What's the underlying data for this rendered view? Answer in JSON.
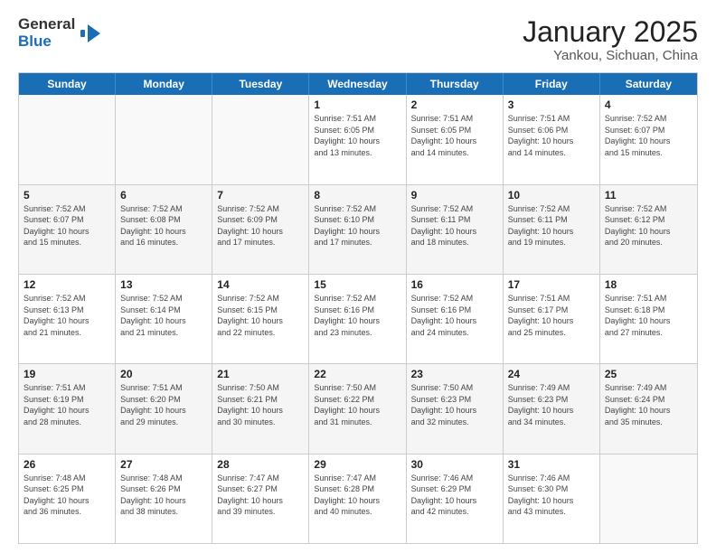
{
  "logo": {
    "text_general": "General",
    "text_blue": "Blue",
    "icon": "▶"
  },
  "title": {
    "month_year": "January 2025",
    "location": "Yankou, Sichuan, China"
  },
  "weekdays": [
    "Sunday",
    "Monday",
    "Tuesday",
    "Wednesday",
    "Thursday",
    "Friday",
    "Saturday"
  ],
  "rows": [
    [
      {
        "day": "",
        "info": ""
      },
      {
        "day": "",
        "info": ""
      },
      {
        "day": "",
        "info": ""
      },
      {
        "day": "1",
        "info": "Sunrise: 7:51 AM\nSunset: 6:05 PM\nDaylight: 10 hours\nand 13 minutes."
      },
      {
        "day": "2",
        "info": "Sunrise: 7:51 AM\nSunset: 6:05 PM\nDaylight: 10 hours\nand 14 minutes."
      },
      {
        "day": "3",
        "info": "Sunrise: 7:51 AM\nSunset: 6:06 PM\nDaylight: 10 hours\nand 14 minutes."
      },
      {
        "day": "4",
        "info": "Sunrise: 7:52 AM\nSunset: 6:07 PM\nDaylight: 10 hours\nand 15 minutes."
      }
    ],
    [
      {
        "day": "5",
        "info": "Sunrise: 7:52 AM\nSunset: 6:07 PM\nDaylight: 10 hours\nand 15 minutes."
      },
      {
        "day": "6",
        "info": "Sunrise: 7:52 AM\nSunset: 6:08 PM\nDaylight: 10 hours\nand 16 minutes."
      },
      {
        "day": "7",
        "info": "Sunrise: 7:52 AM\nSunset: 6:09 PM\nDaylight: 10 hours\nand 17 minutes."
      },
      {
        "day": "8",
        "info": "Sunrise: 7:52 AM\nSunset: 6:10 PM\nDaylight: 10 hours\nand 17 minutes."
      },
      {
        "day": "9",
        "info": "Sunrise: 7:52 AM\nSunset: 6:11 PM\nDaylight: 10 hours\nand 18 minutes."
      },
      {
        "day": "10",
        "info": "Sunrise: 7:52 AM\nSunset: 6:11 PM\nDaylight: 10 hours\nand 19 minutes."
      },
      {
        "day": "11",
        "info": "Sunrise: 7:52 AM\nSunset: 6:12 PM\nDaylight: 10 hours\nand 20 minutes."
      }
    ],
    [
      {
        "day": "12",
        "info": "Sunrise: 7:52 AM\nSunset: 6:13 PM\nDaylight: 10 hours\nand 21 minutes."
      },
      {
        "day": "13",
        "info": "Sunrise: 7:52 AM\nSunset: 6:14 PM\nDaylight: 10 hours\nand 21 minutes."
      },
      {
        "day": "14",
        "info": "Sunrise: 7:52 AM\nSunset: 6:15 PM\nDaylight: 10 hours\nand 22 minutes."
      },
      {
        "day": "15",
        "info": "Sunrise: 7:52 AM\nSunset: 6:16 PM\nDaylight: 10 hours\nand 23 minutes."
      },
      {
        "day": "16",
        "info": "Sunrise: 7:52 AM\nSunset: 6:16 PM\nDaylight: 10 hours\nand 24 minutes."
      },
      {
        "day": "17",
        "info": "Sunrise: 7:51 AM\nSunset: 6:17 PM\nDaylight: 10 hours\nand 25 minutes."
      },
      {
        "day": "18",
        "info": "Sunrise: 7:51 AM\nSunset: 6:18 PM\nDaylight: 10 hours\nand 27 minutes."
      }
    ],
    [
      {
        "day": "19",
        "info": "Sunrise: 7:51 AM\nSunset: 6:19 PM\nDaylight: 10 hours\nand 28 minutes."
      },
      {
        "day": "20",
        "info": "Sunrise: 7:51 AM\nSunset: 6:20 PM\nDaylight: 10 hours\nand 29 minutes."
      },
      {
        "day": "21",
        "info": "Sunrise: 7:50 AM\nSunset: 6:21 PM\nDaylight: 10 hours\nand 30 minutes."
      },
      {
        "day": "22",
        "info": "Sunrise: 7:50 AM\nSunset: 6:22 PM\nDaylight: 10 hours\nand 31 minutes."
      },
      {
        "day": "23",
        "info": "Sunrise: 7:50 AM\nSunset: 6:23 PM\nDaylight: 10 hours\nand 32 minutes."
      },
      {
        "day": "24",
        "info": "Sunrise: 7:49 AM\nSunset: 6:23 PM\nDaylight: 10 hours\nand 34 minutes."
      },
      {
        "day": "25",
        "info": "Sunrise: 7:49 AM\nSunset: 6:24 PM\nDaylight: 10 hours\nand 35 minutes."
      }
    ],
    [
      {
        "day": "26",
        "info": "Sunrise: 7:48 AM\nSunset: 6:25 PM\nDaylight: 10 hours\nand 36 minutes."
      },
      {
        "day": "27",
        "info": "Sunrise: 7:48 AM\nSunset: 6:26 PM\nDaylight: 10 hours\nand 38 minutes."
      },
      {
        "day": "28",
        "info": "Sunrise: 7:47 AM\nSunset: 6:27 PM\nDaylight: 10 hours\nand 39 minutes."
      },
      {
        "day": "29",
        "info": "Sunrise: 7:47 AM\nSunset: 6:28 PM\nDaylight: 10 hours\nand 40 minutes."
      },
      {
        "day": "30",
        "info": "Sunrise: 7:46 AM\nSunset: 6:29 PM\nDaylight: 10 hours\nand 42 minutes."
      },
      {
        "day": "31",
        "info": "Sunrise: 7:46 AM\nSunset: 6:30 PM\nDaylight: 10 hours\nand 43 minutes."
      },
      {
        "day": "",
        "info": ""
      }
    ]
  ]
}
